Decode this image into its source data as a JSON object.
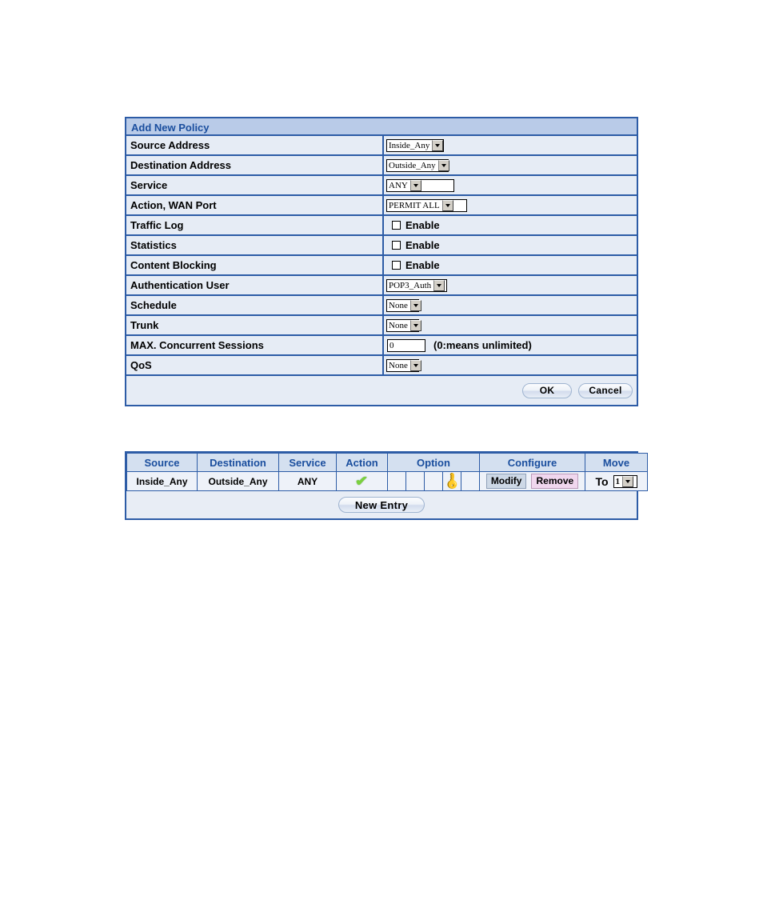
{
  "policy_form": {
    "title": "Add New Policy",
    "rows": [
      {
        "label": "Source Address",
        "type": "select",
        "value": "Inside_Any",
        "width_class": "w-inside"
      },
      {
        "label": "Destination Address",
        "type": "select",
        "value": "Outside_Any",
        "width_class": "w-outside"
      },
      {
        "label": "Service",
        "type": "select",
        "value": "ANY",
        "width_class": "w-any"
      },
      {
        "label": "Action, WAN Port",
        "type": "select",
        "value": "PERMIT ALL",
        "width_class": "w-permit"
      },
      {
        "label": "Traffic Log",
        "type": "checkbox",
        "value": "Enable",
        "checked": false
      },
      {
        "label": "Statistics",
        "type": "checkbox",
        "value": "Enable",
        "checked": false
      },
      {
        "label": "Content Blocking",
        "type": "checkbox",
        "value": "Enable",
        "checked": false
      },
      {
        "label": "Authentication User",
        "type": "select",
        "value": "POP3_Auth",
        "width_class": "w-auth"
      },
      {
        "label": "Schedule",
        "type": "select",
        "value": "None",
        "width_class": "w-none"
      },
      {
        "label": "Trunk",
        "type": "select",
        "value": "None",
        "width_class": "w-none"
      },
      {
        "label": "MAX. Concurrent Sessions",
        "type": "text",
        "value": "0",
        "hint": "(0:means unlimited)"
      },
      {
        "label": "QoS",
        "type": "select",
        "value": "None",
        "width_class": "w-none"
      }
    ],
    "buttons": {
      "ok": "OK",
      "cancel": "Cancel"
    }
  },
  "policy_list": {
    "headers": {
      "source": "Source",
      "destination": "Destination",
      "service": "Service",
      "action": "Action",
      "option": "Option",
      "configure": "Configure",
      "move": "Move"
    },
    "rows": [
      {
        "source": "Inside_Any",
        "destination": "Outside_Any",
        "service": "ANY",
        "action_icon": "green-check-icon",
        "options": [
          "",
          "",
          "key-icon",
          "",
          ""
        ],
        "modify_label": "Modify",
        "remove_label": "Remove",
        "move_label": "To",
        "move_value": "1"
      }
    ],
    "new_entry_label": "New Entry"
  },
  "colors": {
    "border_blue": "#2d5ca6",
    "header_blue": "#b9cbe8",
    "title_text": "#1a4e9e",
    "row_bg": "#e6ecf5",
    "check_green": "#7ad13e",
    "key_yellow": "#f2d024",
    "modify_bg": "#cdd8e6",
    "remove_bg": "#f0d7ee"
  }
}
